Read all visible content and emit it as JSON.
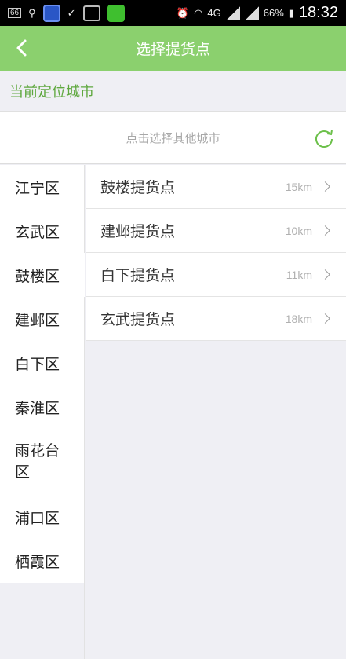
{
  "status_bar": {
    "left_badge": "66",
    "battery": "66%",
    "network_4g": "4G",
    "time": "18:32"
  },
  "header": {
    "title": "选择提货点"
  },
  "location": {
    "label": "当前定位城市",
    "city_hint": "点击选择其他城市"
  },
  "districts": [
    "江宁区",
    "玄武区",
    "鼓楼区",
    "建邺区",
    "白下区",
    "秦淮区",
    "雨花台区",
    "浦口区",
    "栖霞区"
  ],
  "pickup_points": [
    {
      "name": "鼓楼提货点",
      "distance": "15km"
    },
    {
      "name": "建邺提货点",
      "distance": "10km"
    },
    {
      "name": "白下提货点",
      "distance": "11km"
    },
    {
      "name": "玄武提货点",
      "distance": "18km"
    }
  ],
  "colors": {
    "header_green": "#8bd06e",
    "label_green": "#5fa83f"
  }
}
